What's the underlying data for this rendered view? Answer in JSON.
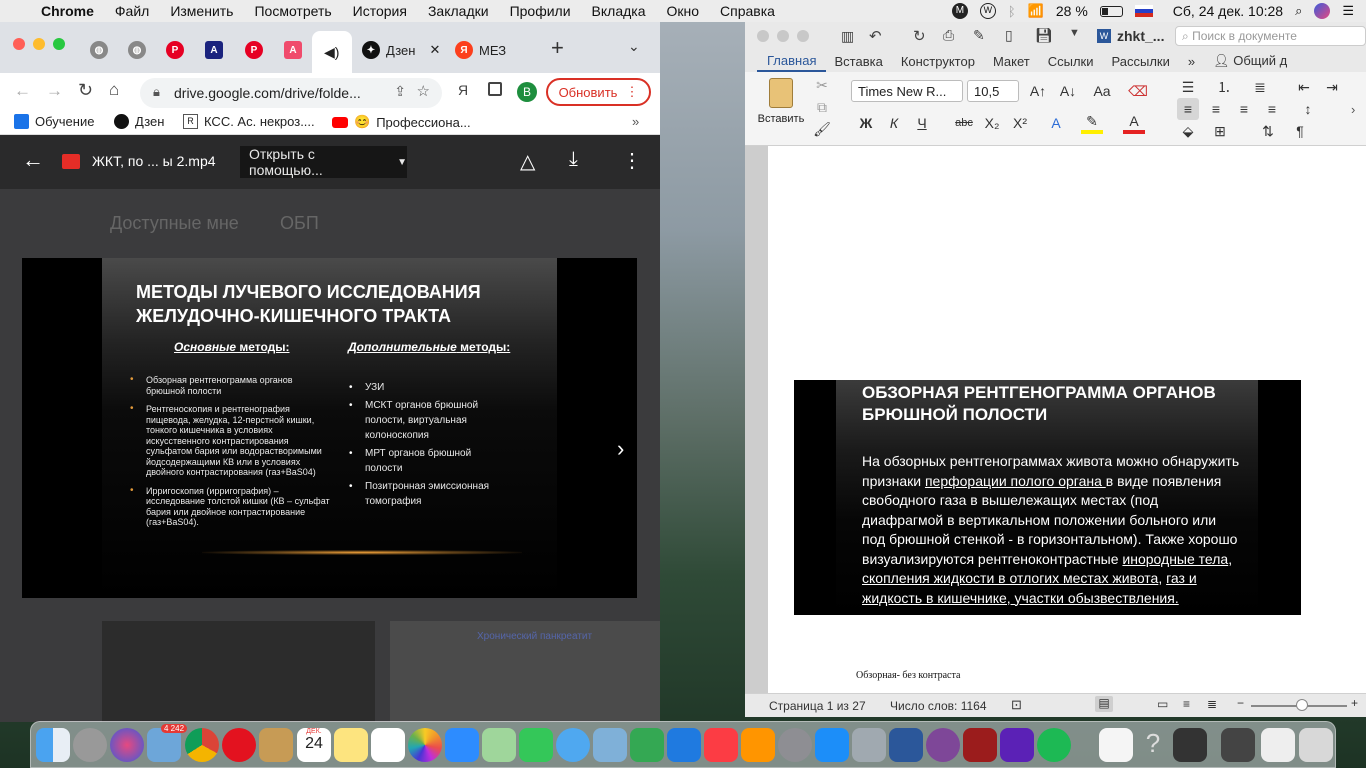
{
  "menubar": {
    "app_name": "Chrome",
    "items": [
      "Файл",
      "Изменить",
      "Посмотреть",
      "История",
      "Закладки",
      "Профили",
      "Вкладка",
      "Окно",
      "Справка"
    ],
    "battery": "28 %",
    "datetime": "Сб, 24 дек.  10:28"
  },
  "chrome": {
    "tabs": [
      {
        "label": "",
        "icon": "globe-icon"
      },
      {
        "label": "",
        "icon": "globe-icon"
      },
      {
        "label": "",
        "icon": "pinterest-icon"
      },
      {
        "label": "",
        "icon": "font-a-icon"
      },
      {
        "label": "",
        "icon": "pinterest-icon"
      },
      {
        "label": "",
        "icon": "app-a-icon"
      },
      {
        "label": "",
        "icon": "speaker-icon"
      },
      {
        "label": "Дзен",
        "icon": "zen-icon"
      },
      {
        "label": "МЕЗ",
        "icon": "yandex-icon"
      }
    ],
    "url": "drive.google.com/drive/folde...",
    "update_label": "Обновить",
    "avatar_letter": "В",
    "bookmarks": [
      {
        "label": "Обучение"
      },
      {
        "label": "Дзен"
      },
      {
        "label": "КСС. Ас. некроз...."
      },
      {
        "label": "Профессиона..."
      }
    ]
  },
  "viewer": {
    "file_name": "ЖКТ, по ... ы 2.mp4",
    "open_with_label": "Открыть с помощью...",
    "bg_breadcrumb_1": "Доступные мне",
    "bg_breadcrumb_2": "ОБП",
    "bg_card_title": "Хронический панкреатит"
  },
  "slide": {
    "title_line1": "МЕТОДЫ ЛУЧЕВОГО ИССЛЕДОВАНИЯ",
    "title_line2": "ЖЕЛУДОЧНО-КИШЕЧНОГО ТРАКТА",
    "left_head_em": "Основные",
    "left_head_rest": " методы:",
    "right_head_em": "Дополнительные",
    "right_head_rest": " методы:",
    "left_items": [
      "Обзорная рентгенограмма органов брюшной полости",
      "Рентгеноскопия и рентгенография пищевода, желудка, 12-перстной кишки, тонкого кишечника в условиях искусственного контрастирования сульфатом бария или водорастворимыми йодсодержащими КВ или в условиях двойного контрастирования (газ+BaS04)",
      "Ирригоскопия (ирригография) – исследование толстой кишки (КВ – сульфат бария или двойное контрастирование (газ+BaS04)."
    ],
    "right_items": [
      "УЗИ",
      "МСКТ  органов брюшной полости, виртуальная колоноскопия",
      " МРТ органов брюшной полости",
      "Позитронная эмиссионная томография"
    ]
  },
  "word": {
    "doc_title": "zhkt_...",
    "search_placeholder": "Поиск в документе",
    "tabs": [
      "Главная",
      "Вставка",
      "Конструктор",
      "Макет",
      "Ссылки",
      "Рассылки"
    ],
    "share_label": "Общий д",
    "paste_label": "Вставить",
    "font_name": "Times New R...",
    "font_size": "10,5",
    "bold": "Ж",
    "italic": "К",
    "underline": "Ч",
    "strike": "abc",
    "slide_title_1": "ОБЗОРНАЯ РЕНТГЕНОГРАММА ОРГАНОВ",
    "slide_title_2": "БРЮШНОЙ ПОЛОСТИ",
    "body_1": "На обзорных рентгенограммах живота можно обнаружить признаки ",
    "link_1": "перфорации полого органа ",
    "body_2": "в виде появления свободного газа в вышележащих местах (под диафрагмой в вертикальном положении больного или под брюшной стенкой - в горизонтальном). Также хорошо визуализируются рентгеноконтрастные ",
    "link_2": "инородные тела",
    "body_3": ", ",
    "link_3": "скопления жидкости в отлогих местах живота",
    "body_4": ", ",
    "link_4": "газ и жидкость в кишечнике, участки обызвествления.",
    "footnote": "Обзорная- без контраста",
    "status_page": "Страница 1 из 27",
    "status_words": "Число слов: 1164"
  },
  "dock": {
    "badge": "4 242",
    "calendar_month": "ДЕК.",
    "calendar_day": "24"
  }
}
